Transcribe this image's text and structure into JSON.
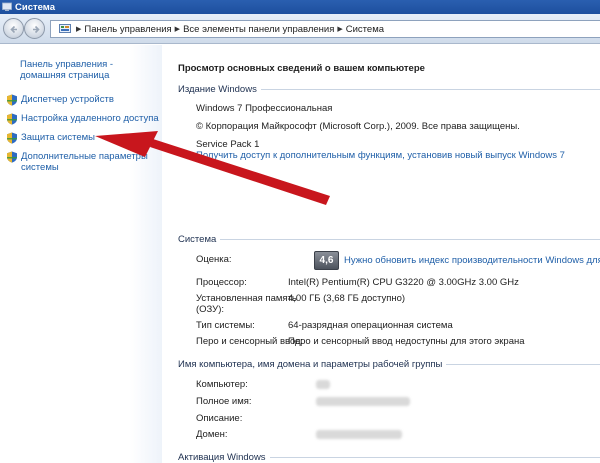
{
  "window": {
    "title": "Система"
  },
  "address_bar": {
    "breadcrumbs": [
      "Панель управления",
      "Все элементы панели управления",
      "Система"
    ]
  },
  "sidebar": {
    "home_link": "Панель управления - домашняя страница",
    "items": [
      {
        "label": "Диспетчер устройств",
        "icon": "shield-icon"
      },
      {
        "label": "Настройка удаленного доступа",
        "icon": "shield-icon"
      },
      {
        "label": "Защита системы",
        "icon": "shield-icon"
      },
      {
        "label": "Дополнительные параметры системы",
        "icon": "shield-icon"
      }
    ]
  },
  "main": {
    "heading": "Просмотр основных сведений о вашем компьютере",
    "edition": {
      "title": "Издание Windows",
      "name": "Windows 7 Профессиональная",
      "copyright": "© Корпорация Майкрософт (Microsoft Corp.), 2009. Все права защищены.",
      "service_pack": "Service Pack 1",
      "upgrade_link": "Получить доступ к дополнительным функциям, установив новый выпуск Windows 7"
    },
    "system": {
      "title": "Система",
      "rating_label": "Оценка:",
      "rating_score": "4,6",
      "rating_link": "Нужно обновить индекс производительности Windows для это",
      "cpu_label": "Процессор:",
      "cpu_value": "Intel(R) Pentium(R) CPU G3220 @ 3.00GHz   3.00 GHz",
      "ram_label_1": "Установленная память",
      "ram_label_2": "(ОЗУ):",
      "ram_value": "4,00 ГБ (3,68 ГБ доступно)",
      "type_label": "Тип системы:",
      "type_value": "64-разрядная операционная система",
      "pen_label": "Перо и сенсорный ввод:",
      "pen_value": "Перо и сенсорный ввод недоступны для этого экрана"
    },
    "computer": {
      "title": "Имя компьютера, имя домена и параметры рабочей группы",
      "computer_label": "Компьютер:",
      "fullname_label": "Полное имя:",
      "description_label": "Описание:",
      "domain_label": "Домен:"
    },
    "activation": {
      "title": "Активация Windows"
    }
  },
  "colors": {
    "link": "#1f5fa8",
    "arrow": "#c8161d",
    "titlebar": "#2a5fb0"
  }
}
